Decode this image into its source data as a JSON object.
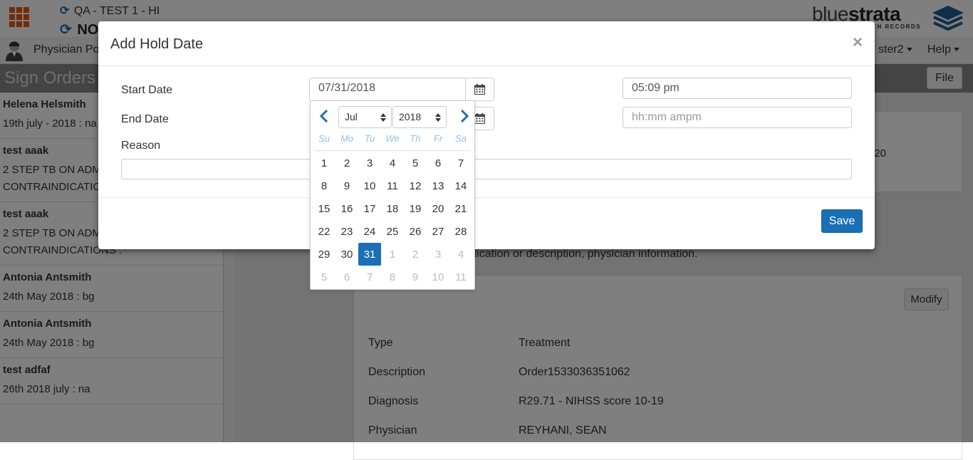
{
  "header": {
    "env_line1": "QA - TEST 1 - HI",
    "env_line2": "NO",
    "logo_word_light": "blue",
    "logo_word_bold": "strata",
    "logo_sub": "ALTH RECORDS"
  },
  "nav": {
    "portal_label": "Physician Por",
    "user_label": "ster2",
    "help_label": "Help"
  },
  "page": {
    "title": "Sign Orders",
    "file_label": "File"
  },
  "sidebar": {
    "items": [
      {
        "name": "Helena Helsmith",
        "lines": [
          "19th july - 2018 : na"
        ]
      },
      {
        "name": "test aaak",
        "lines": [
          "2 STEP TB ON ADM",
          "CONTRAINDICATIO"
        ]
      },
      {
        "name": "test aaak",
        "lines": [
          "2 STEP TB ON ADM",
          "CONTRAINDICATIONS :"
        ]
      },
      {
        "name": "Antonia Antsmith",
        "lines": [
          "24th May 2018 : bg"
        ]
      },
      {
        "name": "Antonia Antsmith",
        "lines": [
          "24th May 2018 : bg"
        ]
      },
      {
        "name": "test adfaf",
        "lines": [
          "26th 2018 july : na"
        ]
      }
    ]
  },
  "main": {
    "top_card_fragment": "20",
    "description": "bout this order. The medication or description, physician information.",
    "modify_label": "Modify",
    "details": [
      {
        "label": "Type",
        "value": "Treatment"
      },
      {
        "label": "Description",
        "value": "Order1533036351062"
      },
      {
        "label": "Diagnosis",
        "value": "R29.71 - NIHSS score 10-19"
      },
      {
        "label": "Physician",
        "value": "REYHANI, SEAN"
      }
    ]
  },
  "modal": {
    "title": "Add Hold Date",
    "close_symbol": "×",
    "start_date_label": "Start Date",
    "start_date_value": "07/31/2018",
    "start_time_value": "05:09 pm",
    "end_date_label": "End Date",
    "end_time_placeholder": "hh:mm ampm",
    "reason_label": "Reason",
    "reason_value": "",
    "save_label": "Save"
  },
  "datepicker": {
    "month": "Jul",
    "year": "2018",
    "weekdays": [
      "Su",
      "Mo",
      "Tu",
      "We",
      "Th",
      "Fr",
      "Sa"
    ],
    "selected_day": "31"
  },
  "colors": {
    "primary": "#1a6fb5",
    "apps_icon": "#e8590c",
    "weekday_text": "#8ec1e3"
  }
}
